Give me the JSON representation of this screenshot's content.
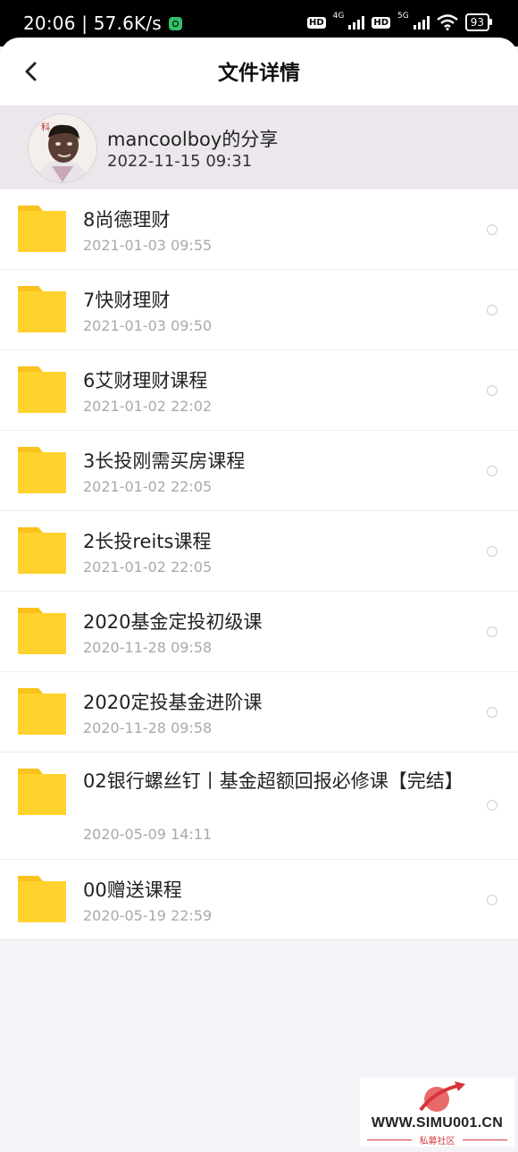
{
  "status_bar": {
    "time_speed": "20:06 | 57.6K/s",
    "hd1": "HD",
    "net1": "4G",
    "hd2": "HD",
    "net2": "5G",
    "battery": "93"
  },
  "header": {
    "title": "文件详情",
    "back_icon": "chevron-left-icon"
  },
  "sharer": {
    "name": "mancoolboy的分享",
    "time": "2022-11-15   09:31"
  },
  "files": [
    {
      "name": "8尚德理财",
      "time": "2021-01-03   09:55"
    },
    {
      "name": "7快财理财",
      "time": "2021-01-03   09:50"
    },
    {
      "name": "6艾财理财课程",
      "time": "2021-01-02   22:02"
    },
    {
      "name": "3长投刚需买房课程",
      "time": "2021-01-02   22:05"
    },
    {
      "name": "2长投reits课程",
      "time": "2021-01-02   22:05"
    },
    {
      "name": "2020基金定投初级课",
      "time": "2020-11-28   09:58"
    },
    {
      "name": "2020定投基金进阶课",
      "time": "2020-11-28   09:58"
    },
    {
      "name": "02银行螺丝钉丨基金超额回报必修课【完结】",
      "time": "2020-05-09   14:11"
    },
    {
      "name": "00赠送课程",
      "time": "2020-05-19   22:59"
    }
  ],
  "watermark": {
    "url": "WWW.SIMU001.CN",
    "sub": "私募社区"
  },
  "colors": {
    "folder": "#ffd22e",
    "folder_tab": "#f9c21c",
    "sharer_bg": "#ebe7ec",
    "page_bg": "#f4f3f8"
  }
}
